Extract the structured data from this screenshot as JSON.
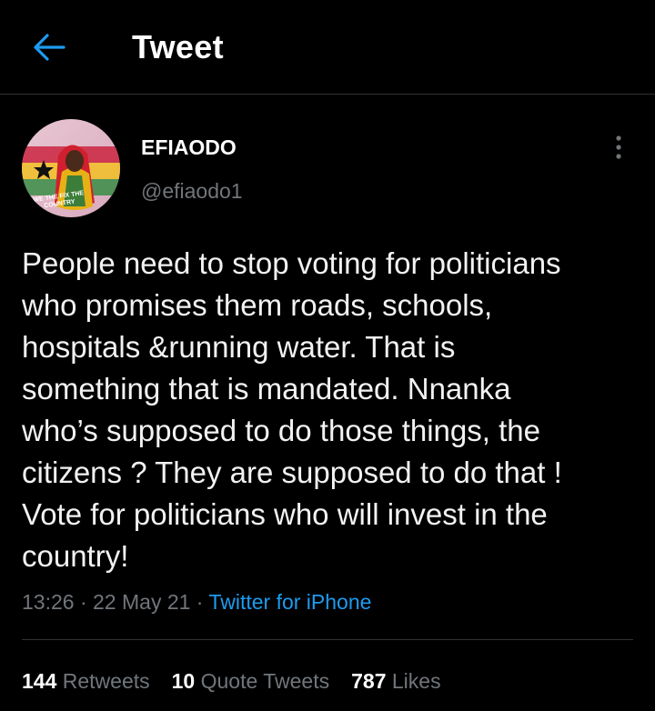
{
  "header": {
    "title": "Tweet",
    "back_icon": "arrow-left-icon"
  },
  "colors": {
    "background": "#000000",
    "accent": "#1d9bf0",
    "muted": "#71767b",
    "divider": "#2f3336"
  },
  "tweet": {
    "author": {
      "display_name": "EFIAODO",
      "handle": "@efiaodo1",
      "avatar_text": "WE THE FIX THE COUNTRY"
    },
    "text": "People need to stop voting for politicians\nwho promises them roads, schools,\nhospitals &running water. That is\nsomething that is mandated. Nnanka\nwho’s supposed to do those things, the\ncitizens ? They are supposed to do that !\nVote for politicians who will invest in the\ncountry!",
    "time": "13:26",
    "separator": " · ",
    "date": "22 May 21",
    "source": "Twitter for iPhone"
  },
  "stats": {
    "retweets": "144",
    "retweets_label": "Retweets",
    "quote_tweets": "10",
    "quote_tweets_label": "Quote Tweets",
    "likes": "787",
    "likes_label": "Likes"
  }
}
